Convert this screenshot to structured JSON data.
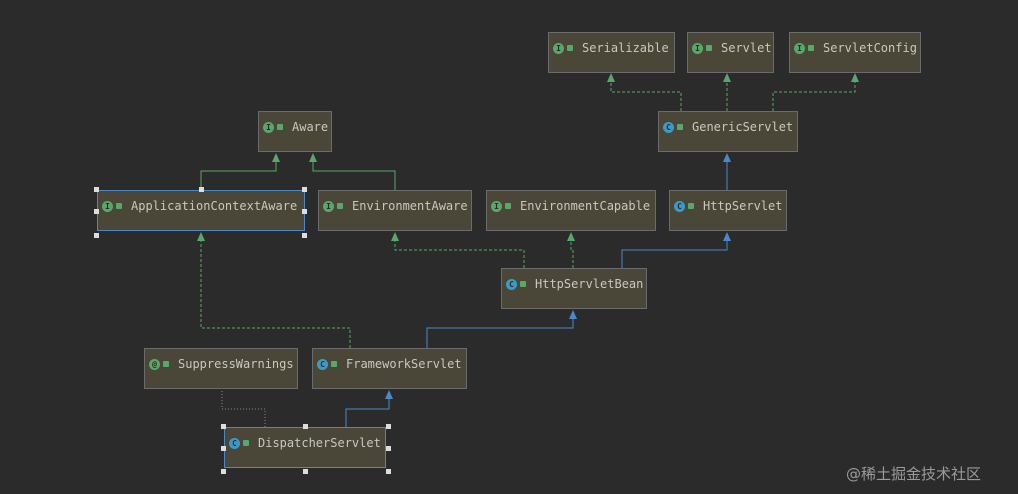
{
  "nodes": {
    "serializable": {
      "name": "Serializable",
      "kind": "interface"
    },
    "servlet": {
      "name": "Servlet",
      "kind": "interface"
    },
    "servlet_config": {
      "name": "ServletConfig",
      "kind": "interface"
    },
    "generic_servlet": {
      "name": "GenericServlet",
      "kind": "abstract-class"
    },
    "aware": {
      "name": "Aware",
      "kind": "interface"
    },
    "application_context_aware": {
      "name": "ApplicationContextAware",
      "kind": "interface"
    },
    "environment_aware": {
      "name": "EnvironmentAware",
      "kind": "interface"
    },
    "environment_capable": {
      "name": "EnvironmentCapable",
      "kind": "interface"
    },
    "http_servlet": {
      "name": "HttpServlet",
      "kind": "abstract-class"
    },
    "http_servlet_bean": {
      "name": "HttpServletBean",
      "kind": "abstract-class"
    },
    "suppress_warnings": {
      "name": "SuppressWarnings",
      "kind": "annotation"
    },
    "framework_servlet": {
      "name": "FrameworkServlet",
      "kind": "abstract-class"
    },
    "dispatcher_servlet": {
      "name": "DispatcherServlet",
      "kind": "class"
    }
  },
  "icon_letters": {
    "interface": "I",
    "class": "C",
    "annotation": "@"
  },
  "colors": {
    "implements": "#59a869",
    "extends": "#4a88c7",
    "node_bg": "#4a4739",
    "background": "#2b2b2b"
  },
  "watermark": "@稀土掘金技术社区"
}
